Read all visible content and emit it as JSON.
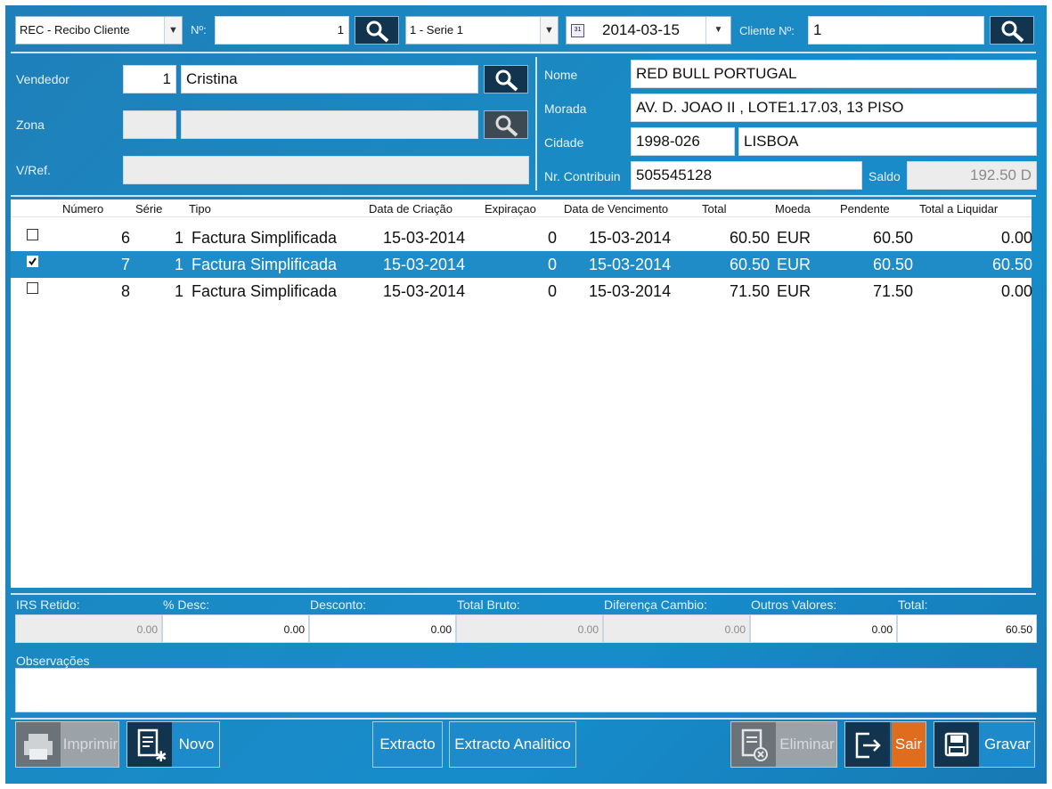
{
  "header": {
    "doc_type": "REC - Recibo Cliente",
    "numero_label": "Nº:",
    "numero_value": "1",
    "serie": "1 - Serie 1",
    "date": "2014-03-15",
    "cliente_label": "Cliente Nº:",
    "cliente_value": "1"
  },
  "left": {
    "vendedor_label": "Vendedor",
    "vendedor_num": "1",
    "vendedor_name": "Cristina",
    "zona_label": "Zona",
    "zona_num": "",
    "zona_name": "",
    "vref_label": "V/Ref.",
    "vref_value": ""
  },
  "right": {
    "nome_label": "Nome",
    "nome_value": "RED BULL PORTUGAL",
    "morada_label": "Morada",
    "morada_value": "AV. D. JOAO II , LOTE1.17.03, 13 PISO",
    "cidade_label": "Cidade",
    "cidade_cp": "1998-026",
    "cidade_value": "LISBOA",
    "contrib_label": "Nr. Contribuin",
    "contrib_value": "505545128",
    "saldo_label": "Saldo",
    "saldo_value": "192.50 D"
  },
  "grid": {
    "columns": [
      "Número",
      "Série",
      "Tipo",
      "Data de Criação",
      "Expiraçao",
      "Data de Vencimento",
      "Total",
      "Moeda",
      "Pendente",
      "Total a Liquidar"
    ],
    "rows": [
      {
        "checked": false,
        "numero": "6",
        "serie": "1",
        "tipo": "Factura Simplificada",
        "criacao": "15-03-2014",
        "expiracao": "0",
        "vencimento": "15-03-2014",
        "total": "60.50",
        "moeda": "EUR",
        "pendente": "60.50",
        "liquidar": "0.00"
      },
      {
        "checked": true,
        "numero": "7",
        "serie": "1",
        "tipo": "Factura Simplificada",
        "criacao": "15-03-2014",
        "expiracao": "0",
        "vencimento": "15-03-2014",
        "total": "60.50",
        "moeda": "EUR",
        "pendente": "60.50",
        "liquidar": "60.50"
      },
      {
        "checked": false,
        "numero": "8",
        "serie": "1",
        "tipo": "Factura Simplificada",
        "criacao": "15-03-2014",
        "expiracao": "0",
        "vencimento": "15-03-2014",
        "total": "71.50",
        "moeda": "EUR",
        "pendente": "71.50",
        "liquidar": "0.00"
      }
    ]
  },
  "totals": {
    "irs_label": "IRS Retido:",
    "irs_value": "0.00",
    "desc_pct_label": "% Desc:",
    "desc_pct_value": "0.00",
    "desconto_label": "Desconto:",
    "desconto_value": "0.00",
    "bruto_label": "Total Bruto:",
    "bruto_value": "0.00",
    "cambio_label": "Diferença Cambio:",
    "cambio_value": "0.00",
    "outros_label": "Outros Valores:",
    "outros_value": "0.00",
    "total_label": "Total:",
    "total_value": "60.50"
  },
  "observacoes_label": "Observações",
  "observacoes_value": "",
  "buttons": {
    "imprimir": "Imprimir",
    "novo": "Novo",
    "extracto": "Extracto",
    "extracto_analitico": "Extracto Analitico",
    "eliminar": "Eliminar",
    "sair": "Sair",
    "gravar": "Gravar"
  },
  "icons": [
    "search-icon",
    "calendar-icon",
    "printer-icon",
    "new-document-icon",
    "delete-document-icon",
    "exit-icon",
    "save-icon",
    "checkbox-checked-icon"
  ],
  "colors": {
    "background": "#1a8ac4",
    "selected_row": "#1f8cc8",
    "icon_button": "#12344f",
    "exit_button": "#e06d1e"
  }
}
